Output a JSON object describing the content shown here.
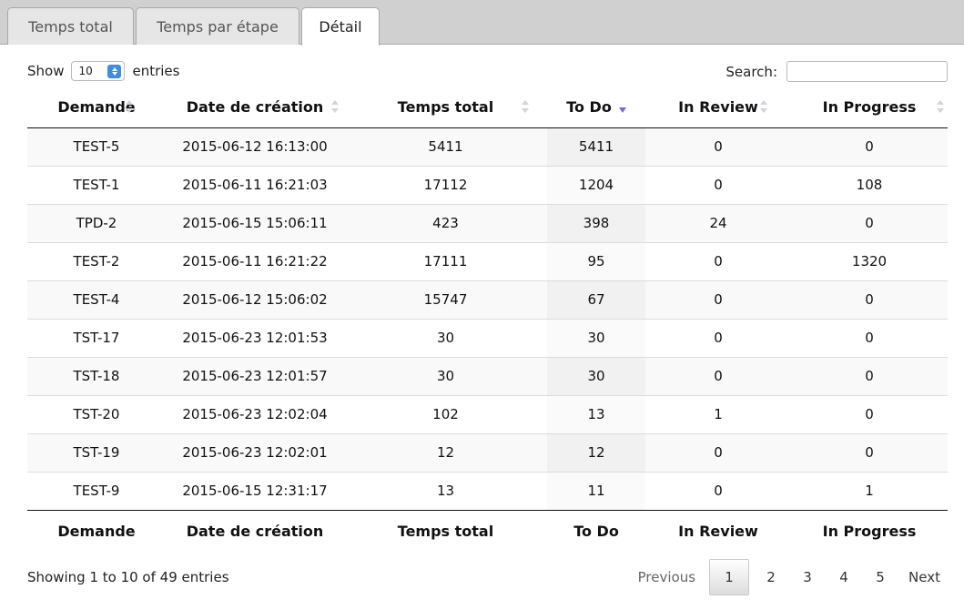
{
  "tabs": [
    {
      "label": "Temps total",
      "active": false
    },
    {
      "label": "Temps par étape",
      "active": false
    },
    {
      "label": "Détail",
      "active": true
    }
  ],
  "length_control": {
    "show_label": "Show",
    "selected": "10",
    "entries_label": "entries"
  },
  "search": {
    "label": "Search:",
    "value": "",
    "placeholder": ""
  },
  "table": {
    "columns": [
      "Demande",
      "Date de création",
      "Temps total",
      "To Do",
      "In Review",
      "In Progress"
    ],
    "sorted_column": "To Do",
    "sort_direction": "descending",
    "rows": [
      [
        "TEST-5",
        "2015-06-12 16:13:00",
        "5411",
        "5411",
        "0",
        "0"
      ],
      [
        "TEST-1",
        "2015-06-11 16:21:03",
        "17112",
        "1204",
        "0",
        "108"
      ],
      [
        "TPD-2",
        "2015-06-15 15:06:11",
        "423",
        "398",
        "24",
        "0"
      ],
      [
        "TEST-2",
        "2015-06-11 16:21:22",
        "17111",
        "95",
        "0",
        "1320"
      ],
      [
        "TEST-4",
        "2015-06-12 15:06:02",
        "15747",
        "67",
        "0",
        "0"
      ],
      [
        "TST-17",
        "2015-06-23 12:01:53",
        "30",
        "30",
        "0",
        "0"
      ],
      [
        "TST-18",
        "2015-06-23 12:01:57",
        "30",
        "30",
        "0",
        "0"
      ],
      [
        "TST-20",
        "2015-06-23 12:02:04",
        "102",
        "13",
        "1",
        "0"
      ],
      [
        "TST-19",
        "2015-06-23 12:02:01",
        "12",
        "12",
        "0",
        "0"
      ],
      [
        "TEST-9",
        "2015-06-15 12:31:17",
        "13",
        "11",
        "0",
        "1"
      ]
    ]
  },
  "info": "Showing 1 to 10 of 49 entries",
  "pagination": {
    "previous": "Previous",
    "pages": [
      "1",
      "2",
      "3",
      "4",
      "5"
    ],
    "current": "1",
    "next": "Next"
  },
  "colors": {
    "tab_bar": "#d0d0d0",
    "sort_active_arrow": "#6e6ed6",
    "select_accent": "#3c8de6"
  }
}
